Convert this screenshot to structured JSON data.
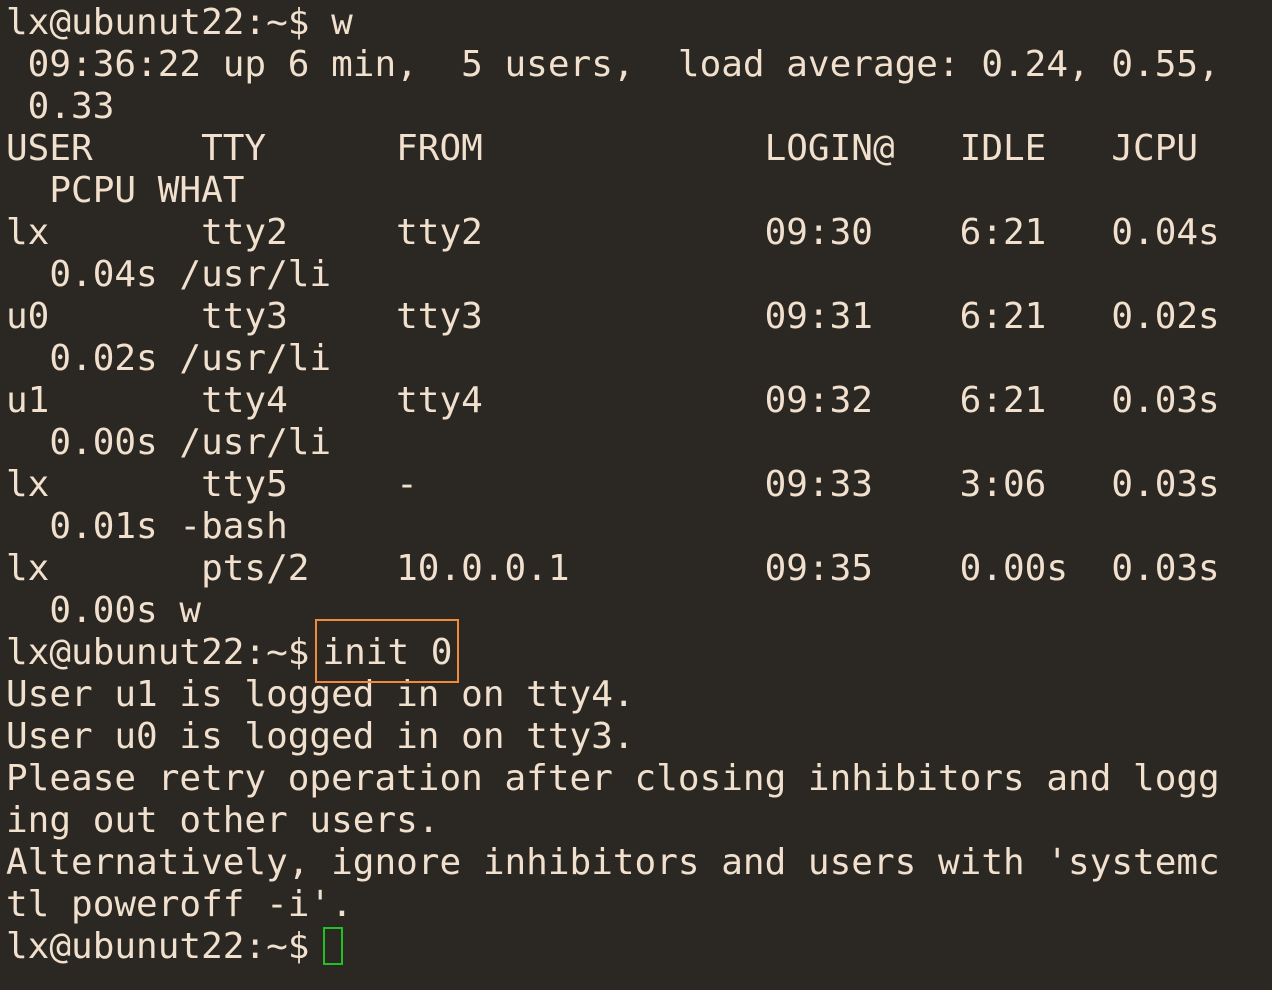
{
  "terminal": {
    "prompt": "lx@ubunut22:~$",
    "lines": [
      {
        "type": "command",
        "prompt": "lx@ubunut22:~$",
        "command": "w"
      },
      {
        "type": "output",
        "text": " 09:36:22 up 6 min,  5 users,  load average: 0.24, 0.55,"
      },
      {
        "type": "output",
        "text": " 0.33"
      },
      {
        "type": "output",
        "text": "USER     TTY      FROM             LOGIN@   IDLE   JCPU"
      },
      {
        "type": "output",
        "text": "  PCPU WHAT"
      },
      {
        "type": "output",
        "text": "lx       tty2     tty2             09:30    6:21   0.04s"
      },
      {
        "type": "output",
        "text": "  0.04s /usr/li"
      },
      {
        "type": "output",
        "text": "u0       tty3     tty3             09:31    6:21   0.02s"
      },
      {
        "type": "output",
        "text": "  0.02s /usr/li"
      },
      {
        "type": "output",
        "text": "u1       tty4     tty4             09:32    6:21   0.03s"
      },
      {
        "type": "output",
        "text": "  0.00s /usr/li"
      },
      {
        "type": "output",
        "text": "lx       tty5     -                09:33    3:06   0.03s"
      },
      {
        "type": "output",
        "text": "  0.01s -bash"
      },
      {
        "type": "output",
        "text": "lx       pts/2    10.0.0.1         09:35    0.00s  0.03s"
      },
      {
        "type": "output",
        "text": "  0.00s w"
      },
      {
        "type": "command-highlighted",
        "prompt": "lx@ubunut22:~$",
        "command": "init 0"
      },
      {
        "type": "output",
        "text": "User u1 is logged in on tty4."
      },
      {
        "type": "output",
        "text": "User u0 is logged in on tty3."
      },
      {
        "type": "output",
        "text": "Please retry operation after closing inhibitors and logg"
      },
      {
        "type": "output",
        "text": "ing out other users."
      },
      {
        "type": "output",
        "text": "Alternatively, ignore inhibitors and users with 'systemc"
      },
      {
        "type": "output",
        "text": "tl poweroff -i'."
      },
      {
        "type": "prompt-cursor",
        "prompt": "lx@ubunut22:~$",
        "command": ""
      }
    ]
  },
  "colors": {
    "background": "#2b2823",
    "text": "#f0e0cd",
    "highlight_border": "#f08a3c",
    "cursor_border": "#22c022"
  }
}
